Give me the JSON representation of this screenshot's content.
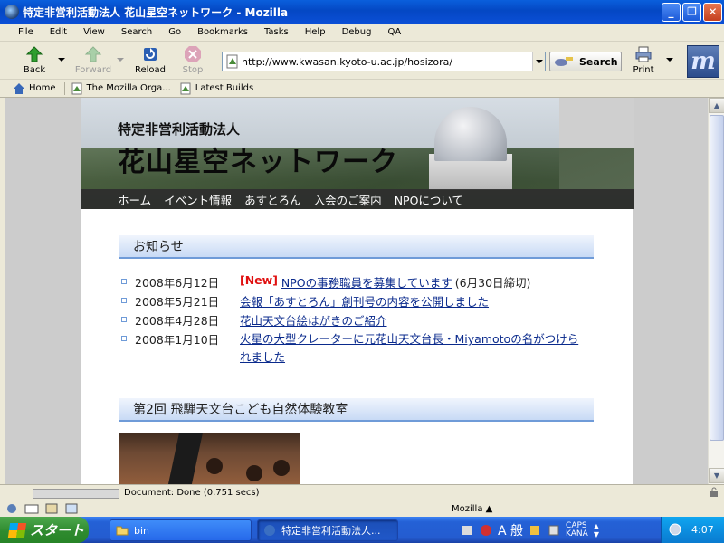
{
  "window": {
    "title": "特定非営利活動法人 花山星空ネットワーク - Mozilla"
  },
  "menu": [
    "File",
    "Edit",
    "View",
    "Search",
    "Go",
    "Bookmarks",
    "Tasks",
    "Help",
    "Debug",
    "QA"
  ],
  "toolbar": {
    "back_label": "Back",
    "forward_label": "Forward",
    "reload_label": "Reload",
    "stop_label": "Stop",
    "url": "http://www.kwasan.kyoto-u.ac.jp/hosizora/",
    "search_label": "Search",
    "print_label": "Print"
  },
  "personal_toolbar": [
    "Home",
    "The Mozilla Orga...",
    "Latest Builds"
  ],
  "page": {
    "org_type": "特定非営利活動法人",
    "site_name": "花山星空ネットワーク",
    "nav": [
      "ホーム",
      "イベント情報",
      "あすとろん",
      "入会のご案内",
      "NPOについて"
    ],
    "notices_title": "お知らせ",
    "news": [
      {
        "date": "2008年6月12日",
        "badge": "[New]",
        "link": "NPOの事務職員を募集しています",
        "note": "(6月30日締切)"
      },
      {
        "date": "2008年5月21日",
        "link": "会報「あすとろん」創刊号の内容を公開しました"
      },
      {
        "date": "2008年4月28日",
        "link": "花山天文台絵はがきのご紹介"
      },
      {
        "date": "2008年1月10日",
        "link_line1": "火星の大型クレーターに元花山天文台長・Miyamotoの名がつけら",
        "link_line2": "れました"
      }
    ],
    "event_title": "第2回 飛騨天文台こども自然体験教室"
  },
  "statusbar": {
    "text": "Document: Done (0.751 secs)",
    "component": "Mozilla ▲"
  },
  "taskbar": {
    "start_label": "スタート",
    "tasks": [
      "bin",
      "特定非営利活動法人..."
    ],
    "lang_ime": "A 般",
    "caps": "CAPS",
    "kana": "KANA",
    "clock": "4:07"
  }
}
